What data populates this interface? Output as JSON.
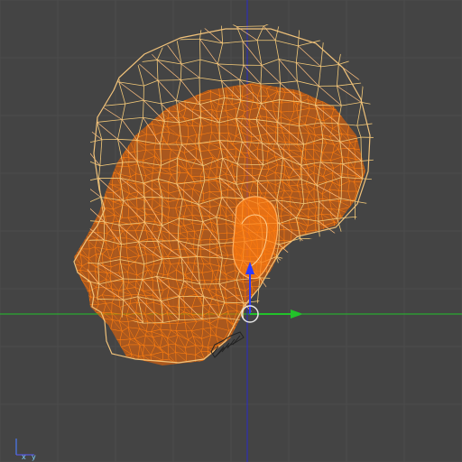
{
  "viewport": {
    "background": "#444444",
    "grid_color": "#4c4c4c",
    "view": "left"
  },
  "axes": {
    "x_color": "#22c22a",
    "y_color": "#2a2ac8",
    "z_color": "#1f2aa0"
  },
  "model": {
    "render_mode": "wireframe",
    "surface_color": "#ff6a00",
    "inner_wire_color": "#ff7f10",
    "outer_wire_color": "#f3c978",
    "highlight_wire_color": "#ffc080"
  },
  "gizmo": {
    "x_arrow_color": "#22c22a",
    "y_arrow_color": "#2d3bff",
    "center_ring_color": "#e6e6e6"
  },
  "orientation_indicator": {
    "x_label": "x",
    "y_label": "y"
  }
}
